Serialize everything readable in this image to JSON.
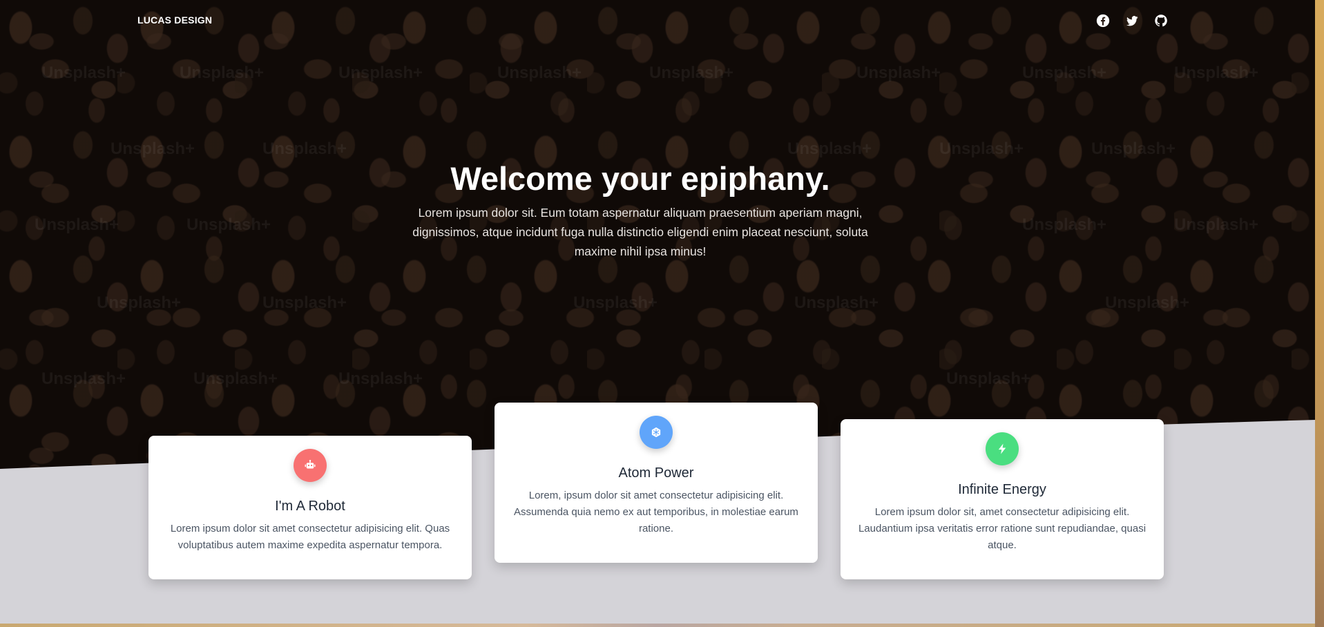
{
  "nav": {
    "brand": "LUCAS DESIGN",
    "social": [
      {
        "icon": "facebook-icon"
      },
      {
        "icon": "twitter-icon"
      },
      {
        "icon": "github-icon"
      }
    ]
  },
  "hero": {
    "title": "Welcome your epiphany.",
    "subtitle": "Lorem ipsum dolor sit. Eum totam aspernatur aliquam praesentium aperiam magni, dignissimos, atque incidunt fuga nulla distinctio eligendi enim placeat nesciunt, soluta maxime nihil ipsa minus!",
    "watermark": "Unsplash+"
  },
  "cards": [
    {
      "icon": "robot-icon",
      "icon_color": "#f87171",
      "title": "I'm A Robot",
      "text": "Lorem ipsum dolor sit amet consectetur adipisicing elit. Quas voluptatibus autem maxime expedita aspernatur tempora."
    },
    {
      "icon": "atom-icon",
      "icon_color": "#60a5fa",
      "title": "Atom Power",
      "text": "Lorem, ipsum dolor sit amet consectetur adipisicing elit. Assumenda quia nemo ex aut temporibus, in molestiae earum ratione."
    },
    {
      "icon": "bolt-icon",
      "icon_color": "#4ade80",
      "title": "Infinite Energy",
      "text": "Lorem ipsum dolor sit, amet consectetur adipisicing elit. Laudantium ipsa veritatis error ratione sunt repudiandae, quasi atque."
    }
  ],
  "colors": {
    "page_bg": "#d4d3d8",
    "card_bg": "#ffffff",
    "hero_overlay": "#1c120d"
  }
}
